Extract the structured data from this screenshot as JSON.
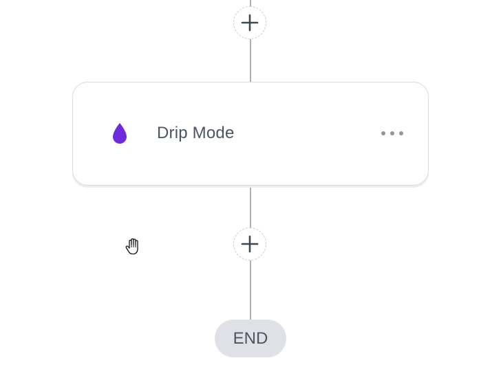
{
  "flow": {
    "node": {
      "label": "Drip Mode",
      "icon": "droplet-icon",
      "icon_color": "#6d2bd9"
    },
    "end_label": "END"
  },
  "colors": {
    "connector": "#a9b0b6",
    "card_border": "#d7dae0",
    "end_pill_bg": "#dfe1e7",
    "text": "#4b5462",
    "menu_dots": "#8f96a0"
  }
}
